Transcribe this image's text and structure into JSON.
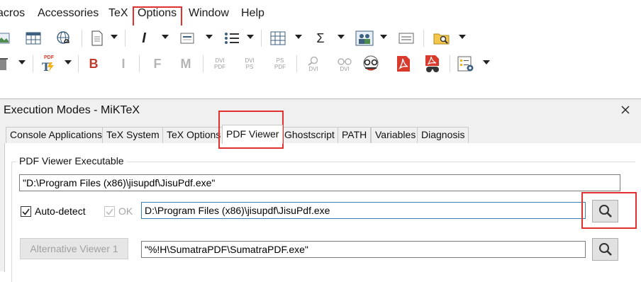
{
  "menubar": {
    "items": [
      "acros",
      "Accessories",
      "TeX",
      "Options",
      "Window",
      "Help"
    ]
  },
  "toolbar2": {
    "bold": "B",
    "italic": "I",
    "f": "F",
    "m": "M",
    "dvi_pdf": "DVI\nPDF",
    "dvi_ps": "DVI\nPS",
    "ps_pdf": "PS\nPDF",
    "dvi_a": "DVI",
    "dvi_b": "DVI",
    "pdf_badge": "PDF"
  },
  "toolbar1": {
    "sigma": "Σ"
  },
  "dialog": {
    "title": "Execution Modes - MiKTeX",
    "tabs": [
      "Console Applications",
      "TeX System",
      "TeX Options",
      "PDF Viewer",
      "Ghostscript",
      "PATH",
      "Variables",
      "Diagnosis"
    ],
    "active_tab": "PDF Viewer",
    "group_label": "PDF Viewer Executable",
    "executable_value": "\"D:\\Program Files (x86)\\jisupdf\\JisuPdf.exe\"",
    "autodetect_label": "Auto-detect",
    "ok_label": "OK",
    "autodetect_path": "D:\\Program Files (x86)\\jisupdf\\JisuPdf.exe",
    "alt_viewer_button": "Alternative Viewer 1",
    "alt_viewer_value": "\"%!H\\SumatraPDF\\SumatraPDF.exe\""
  },
  "colors": {
    "highlight": "#e0312f",
    "pdf_red": "#d93a2b",
    "bold_red": "#c0392b"
  }
}
